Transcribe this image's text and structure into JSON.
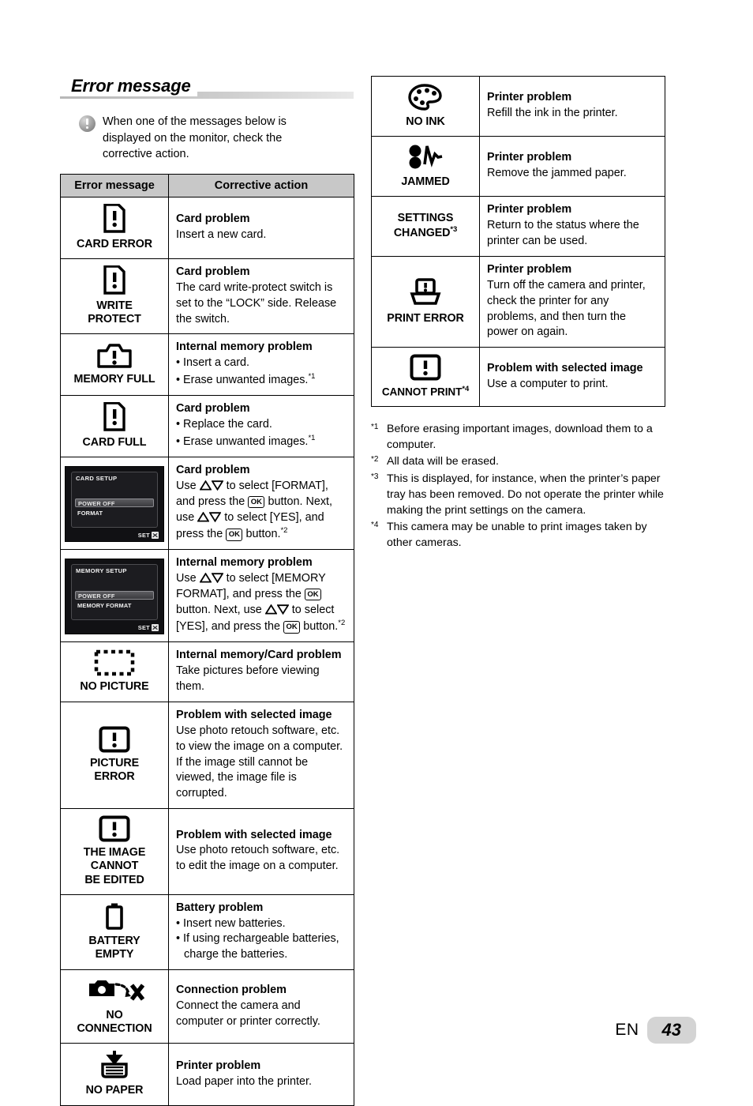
{
  "page": {
    "heading": "Error message",
    "note": "When one of the messages below is displayed on the monitor, check the corrective action.",
    "footer_lang": "EN",
    "footer_page": "43"
  },
  "table": {
    "headers": {
      "col1": "Error message",
      "col2": "Corrective action"
    }
  },
  "left_rows": [
    {
      "icon": "card-error-icon",
      "label": "CARD ERROR",
      "title": "Card problem",
      "lines": [
        "Insert a new card."
      ]
    },
    {
      "icon": "write-protect-icon",
      "label": "WRITE\nPROTECT",
      "title": "Card problem",
      "lines": [
        "The card write-protect switch is set to the “LOCK” side. Release the switch."
      ]
    },
    {
      "icon": "memory-full-icon",
      "label": "MEMORY FULL",
      "title": "Internal memory problem",
      "bullets": [
        "Insert a card.",
        "Erase unwanted images."
      ],
      "bullet_sup": [
        "",
        "*1"
      ]
    },
    {
      "icon": "card-full-icon",
      "label": "CARD FULL",
      "title": "Card problem",
      "bullets": [
        "Replace the card.",
        "Erase unwanted images."
      ],
      "bullet_sup": [
        "",
        "*1"
      ]
    },
    {
      "icon": "lcd-card-setup",
      "label": "",
      "title": "Card problem",
      "lcd": {
        "title": "CARD SETUP",
        "selected": "POWER OFF",
        "item2": "FORMAT",
        "set": "SET"
      },
      "sup": "*2"
    },
    {
      "icon": "lcd-memory-setup",
      "label": "",
      "title": "Internal memory problem",
      "lcd": {
        "title": "MEMORY SETUP",
        "selected": "POWER OFF",
        "item2": "MEMORY FORMAT",
        "set": "SET"
      },
      "sup": "*2"
    },
    {
      "icon": "no-picture-icon",
      "label": "NO PICTURE",
      "title": "Internal memory/Card problem",
      "lines": [
        "Take pictures before viewing them."
      ]
    },
    {
      "icon": "picture-error-icon",
      "label": "PICTURE\nERROR",
      "title": "Problem with selected image",
      "lines": [
        "Use photo retouch software, etc. to view the image on a computer. If the image still cannot be viewed, the image file is corrupted."
      ]
    },
    {
      "icon": "image-cannot-be-edited-icon",
      "label": "THE IMAGE\nCANNOT\nBE EDITED",
      "title": "Problem with selected image",
      "lines": [
        "Use photo retouch software, etc. to edit the image on a computer."
      ]
    },
    {
      "icon": "battery-empty-icon",
      "label": "BATTERY\nEMPTY",
      "title": "Battery problem",
      "bullets": [
        "Insert new batteries.",
        "If using rechargeable batteries, charge the batteries."
      ],
      "bullet_sup": [
        "",
        ""
      ]
    },
    {
      "icon": "no-connection-icon",
      "label": "NO\nCONNECTION",
      "title": "Connection problem",
      "lines": [
        "Connect the camera and computer or printer correctly."
      ]
    },
    {
      "icon": "no-paper-icon",
      "label": "NO PAPER",
      "title": "Printer problem",
      "lines": [
        "Load paper into the printer."
      ]
    }
  ],
  "right_rows": [
    {
      "icon": "no-ink-icon",
      "label": "NO INK",
      "title": "Printer problem",
      "lines": [
        "Refill the ink in the printer."
      ]
    },
    {
      "icon": "jammed-icon",
      "label": "JAMMED",
      "title": "Printer problem",
      "lines": [
        "Remove the jammed paper."
      ]
    },
    {
      "icon": "",
      "label": "SETTINGS\nCHANGED",
      "label_sup": "*3",
      "title": "Printer problem",
      "lines": [
        "Return to the status where the printer can be used."
      ]
    },
    {
      "icon": "print-error-icon",
      "label": "PRINT ERROR",
      "title": "Printer problem",
      "lines": [
        "Turn off the camera and printer, check the printer for any problems, and then turn the power on again."
      ]
    },
    {
      "icon": "cannot-print-icon",
      "label": "CANNOT PRINT",
      "label_sup": "*4",
      "title": "Problem with selected image",
      "lines": [
        "Use a computer to print."
      ]
    }
  ],
  "format_instructions": {
    "card": {
      "p1": "Use ",
      "p2": " to select [FORMAT], and press the ",
      "p3": " button. Next, use ",
      "p4": " to select [YES], and press the ",
      "p5": " button.",
      "ok": "OK",
      "sup": "*2"
    },
    "memory": {
      "p1": "Use ",
      "p2": " to select [MEMORY FORMAT], and press the ",
      "p3": " button. Next, use ",
      "p4": " to select [YES], and press the ",
      "p5": " button.",
      "ok": "OK",
      "sup": "*2"
    }
  },
  "footnotes": [
    {
      "mark": "*1",
      "text": "Before erasing important images, download them to a computer."
    },
    {
      "mark": "*2",
      "text": "All data will be erased."
    },
    {
      "mark": "*3",
      "text": "This is displayed, for instance, when the printer’s paper tray has been removed. Do not operate the printer while making the print settings on the camera."
    },
    {
      "mark": "*4",
      "text": "This camera may be unable to print images taken by other cameras."
    }
  ]
}
